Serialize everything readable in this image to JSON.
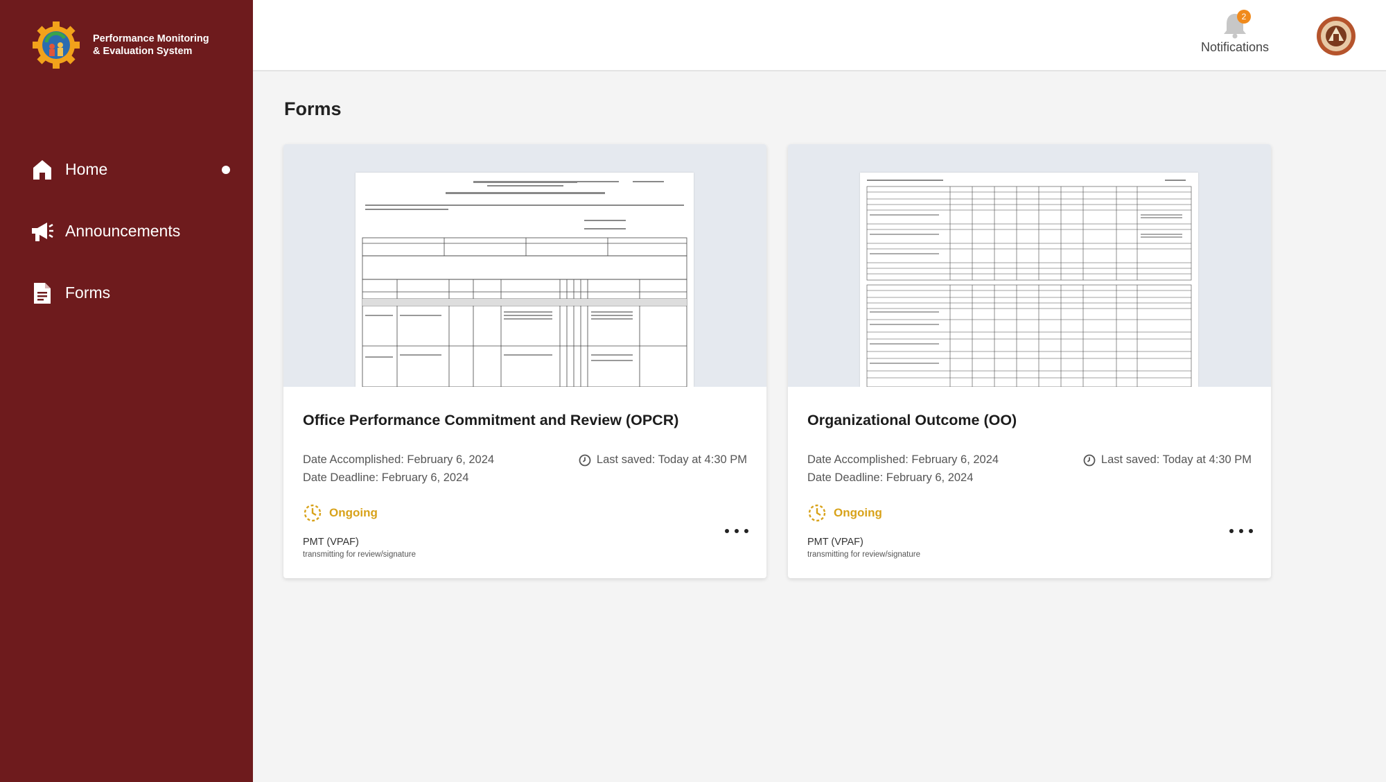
{
  "app": {
    "title_line1": "Performance Monitoring",
    "title_line2": "& Evaluation System",
    "logo_icon": "gear-logo-icon"
  },
  "sidebar": {
    "items": [
      {
        "label": "Home",
        "icon": "home-icon",
        "active": true
      },
      {
        "label": "Announcements",
        "icon": "megaphone-icon",
        "active": false
      },
      {
        "label": "Forms",
        "icon": "document-icon",
        "active": false
      }
    ]
  },
  "header": {
    "notifications_label": "Notifications",
    "notifications_count": "2",
    "avatar_icon": "avatar"
  },
  "main": {
    "title": "Forms",
    "cards": [
      {
        "title": "Office Performance Commitment and Review (OPCR)",
        "date_accomplished": "Date Accomplished: February 6, 2024",
        "date_deadline": "Date Deadline: February 6, 2024",
        "last_saved": "Last saved: Today at 4:30 PM",
        "status": "Ongoing",
        "assignee": "PMT (VPAF)",
        "substatus": "transmitting for review/signature"
      },
      {
        "title": "Organizational Outcome (OO)",
        "date_accomplished": "Date Accomplished: February 6, 2024",
        "date_deadline": "Date Deadline: February 6, 2024",
        "last_saved": "Last saved: Today at 4:30 PM",
        "status": "Ongoing",
        "assignee": "PMT (VPAF)",
        "substatus": "transmitting for review/signature"
      }
    ]
  },
  "colors": {
    "sidebar_bg": "#6e1b1d",
    "status_ongoing": "#d8a21a",
    "badge": "#f08a1c"
  }
}
